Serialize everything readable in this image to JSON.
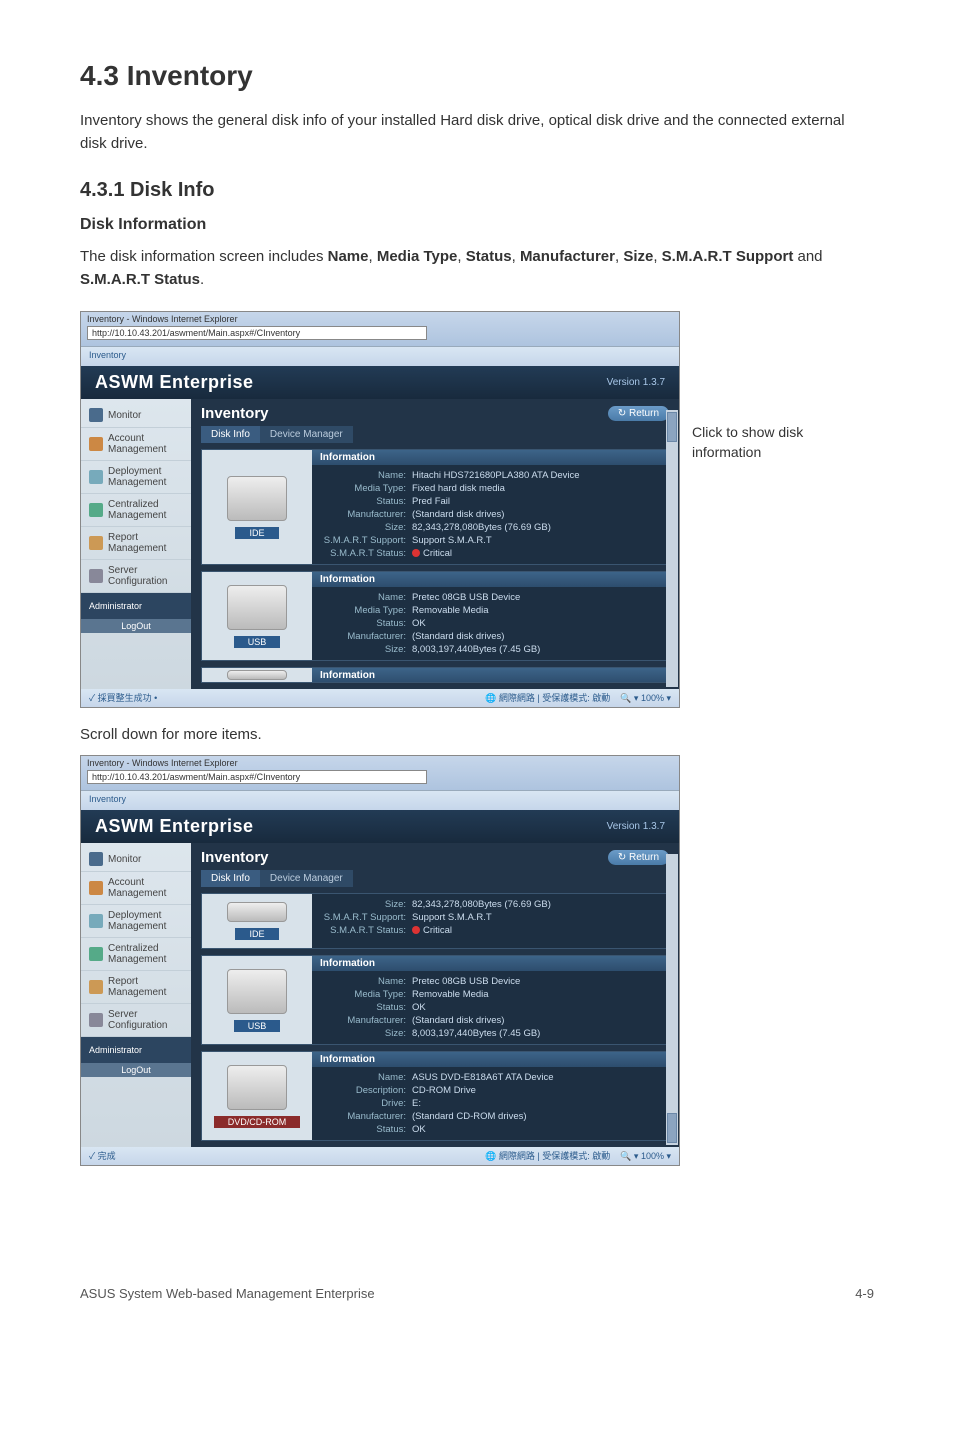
{
  "h1": "4.3      Inventory",
  "intro": "Inventory shows the general disk info of your installed Hard disk drive, optical disk drive and the connected external disk drive.",
  "h2": "4.3.1      Disk Info",
  "h3": "Disk Information",
  "desc_pre": "The disk information screen includes ",
  "fields": {
    "f1": "Name",
    "f2": "Media Type",
    "f3": "Status",
    "f4": "Manufacturer",
    "f5": "Size",
    "f6": "S.M.A.R.T Support",
    "f7": "S.M.A.R.T Status"
  },
  "desc_sep": ", ",
  "desc_and": " and ",
  "desc_end": ".",
  "callout": "Click to show disk information",
  "scroll_note": "Scroll down for more items.",
  "footer_left": "ASUS System Web-based Management Enterprise",
  "footer_right": "4-9",
  "browser": {
    "title": "Inventory - Windows Internet Explorer",
    "url": "http://10.10.43.201/aswment/Main.aspx#/CInventory",
    "tab": "Inventory",
    "status_mode": "網際網路 | 受保護模式: 啟動",
    "zoom": "100%"
  },
  "aswm": {
    "brand": "ASWM Enterprise",
    "version": "Version 1.3.7",
    "page_title": "Inventory",
    "return": "Return",
    "tabs": {
      "t1": "Disk Info",
      "t2": "Device Manager"
    },
    "sidebar": {
      "s1": "Monitor",
      "s2": "Account Management",
      "s3": "Deployment Management",
      "s4": "Centralized Management",
      "s5": "Report Management",
      "s6": "Server Configuration",
      "admin": "Administrator",
      "logout": "LogOut"
    },
    "info_header": "Information",
    "labels": {
      "name": "Name:",
      "media": "Media Type:",
      "status": "Status:",
      "manu": "Manufacturer:",
      "size": "Size:",
      "smart_sup": "S.M.A.R.T Support:",
      "smart_stat": "S.M.A.R.T Status:",
      "desc": "Description:",
      "drive": "Drive:"
    },
    "bus": {
      "ide": "IDE",
      "usb": "USB",
      "dvd": "DVD/CD-ROM"
    },
    "shot1": {
      "d1": {
        "name": "Hitachi HDS721680PLA380 ATA Device",
        "media": "Fixed hard disk media",
        "status": "Pred Fail",
        "manu": "(Standard disk drives)",
        "size": "82,343,278,080Bytes (76.69 GB)",
        "smart_sup": "Support S.M.A.R.T",
        "smart_stat": "Critical"
      },
      "d2": {
        "name": "Pretec 08GB USB Device",
        "media": "Removable Media",
        "status": "OK",
        "manu": "(Standard disk drives)",
        "size": "8,003,197,440Bytes (7.45 GB)"
      }
    },
    "shot2": {
      "d1": {
        "size": "82,343,278,080Bytes (76.69 GB)",
        "smart_sup": "Support S.M.A.R.T",
        "smart_stat": "Critical"
      },
      "d2": {
        "name": "Pretec 08GB USB Device",
        "media": "Removable Media",
        "status": "OK",
        "manu": "(Standard disk drives)",
        "size": "8,003,197,440Bytes (7.45 GB)"
      },
      "d3": {
        "name": "ASUS DVD-E818A6T ATA Device",
        "desc": "CD-ROM Drive",
        "drive": "E:",
        "manu": "(Standard CD-ROM drives)",
        "status": "OK"
      }
    }
  }
}
